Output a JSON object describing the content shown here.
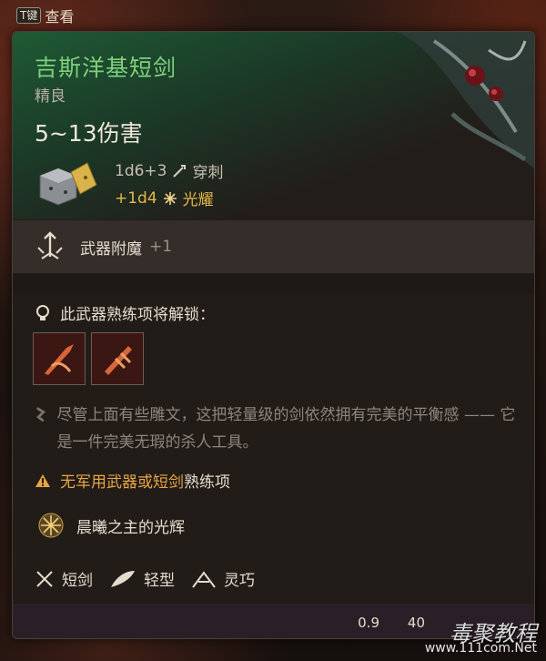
{
  "hotkey": {
    "key": "T键",
    "label": "查看"
  },
  "item": {
    "name": "吉斯洋基短剑",
    "rarity": "精良",
    "damage": "5~13伤害",
    "dice_main": "1d6+3",
    "dmg_type_main": "穿刺",
    "dice_bonus": "+1d4",
    "dmg_type_bonus": "光耀"
  },
  "enchant": {
    "label": "武器附魔",
    "bonus": "+1"
  },
  "unlock": {
    "title": "此武器熟练项将解锁："
  },
  "flavor": {
    "text": "尽管上面有些雕文，这把轻量级的剑依然拥有完美的平衡感 —— 它是一件完美无瑕的杀人工具。"
  },
  "warning": {
    "highlight": "无军用武器或短剑",
    "rest": "熟练项"
  },
  "passive": {
    "label": "晨曦之主的光辉"
  },
  "tags": [
    {
      "label": "短剑",
      "icon": "crossed-swords-icon"
    },
    {
      "label": "轻型",
      "icon": "feather-icon"
    },
    {
      "label": "灵巧",
      "icon": "finesse-icon"
    }
  ],
  "footer": {
    "weight": "0.9",
    "value": "40"
  },
  "watermark": {
    "text": "毒聚教程",
    "url": "www.111com.Net"
  },
  "colors": {
    "name": "#7fd07c",
    "bonus_damage": "#e5b84a",
    "warning": "#e8a543",
    "header_green": "#1f5a34"
  }
}
